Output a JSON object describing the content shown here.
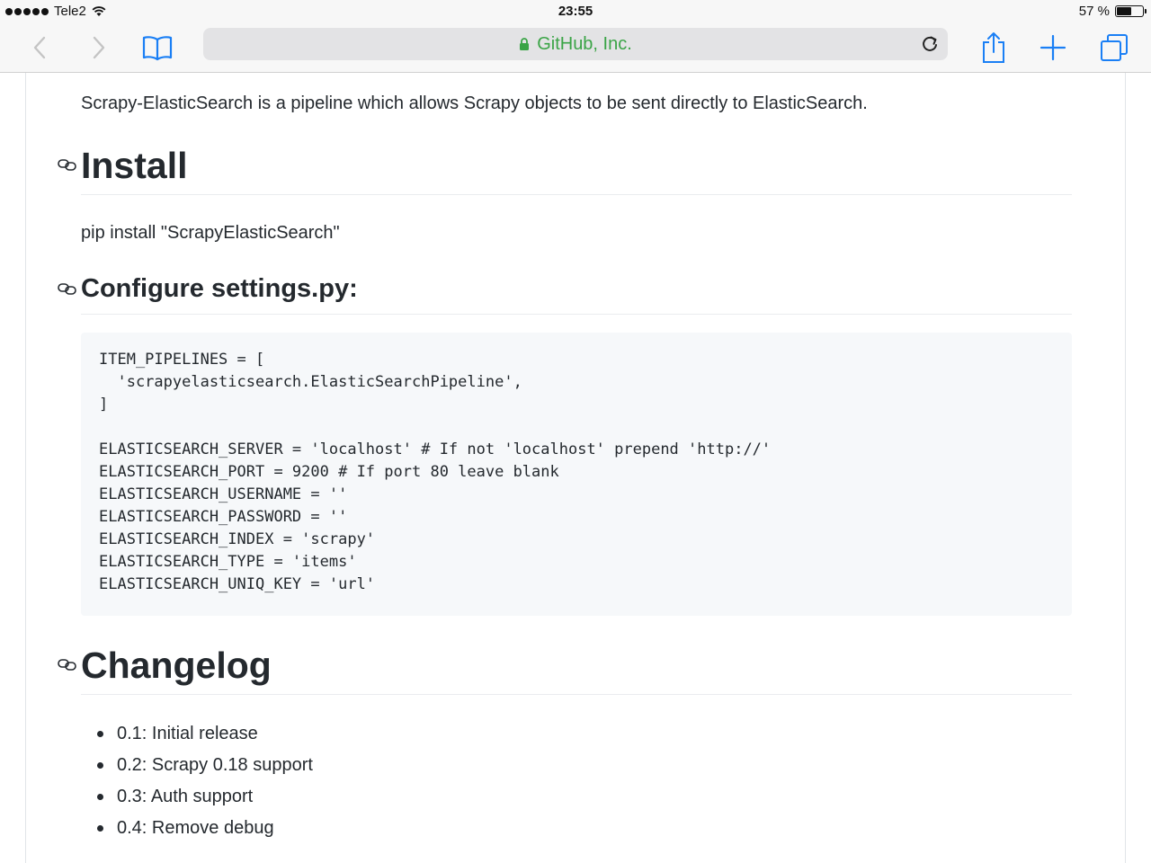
{
  "status_bar": {
    "carrier": "Tele2",
    "time": "23:55",
    "battery_label": "57 %",
    "battery_level": 0.57
  },
  "toolbar": {
    "url_text": "GitHub, Inc.",
    "icons": [
      "back-icon",
      "forward-icon",
      "bookmarks-icon",
      "lock-icon",
      "reload-icon",
      "share-icon",
      "new-tab-icon",
      "tabs-icon"
    ],
    "url_color": "#3aa446",
    "icon_color": "#1a7ff5"
  },
  "content": {
    "intro": "Scrapy-ElasticSearch is a pipeline which allows Scrapy objects to be sent directly to ElasticSearch.",
    "install_heading": "Install",
    "install_command": "pip install \"ScrapyElasticSearch\"",
    "configure_heading": "Configure settings.py:",
    "code_lines": [
      "ITEM_PIPELINES = [",
      "  'scrapyelasticsearch.ElasticSearchPipeline',",
      "]",
      "",
      "ELASTICSEARCH_SERVER = 'localhost' # If not 'localhost' prepend 'http://'",
      "ELASTICSEARCH_PORT = 9200 # If port 80 leave blank",
      "ELASTICSEARCH_USERNAME = ''",
      "ELASTICSEARCH_PASSWORD = ''",
      "ELASTICSEARCH_INDEX = 'scrapy'",
      "ELASTICSEARCH_TYPE = 'items'",
      "ELASTICSEARCH_UNIQ_KEY = 'url'"
    ],
    "changelog_heading": "Changelog",
    "changelog_items": [
      "0.1: Initial release",
      "0.2: Scrapy 0.18 support",
      "0.3: Auth support",
      "0.4: Remove debug"
    ]
  }
}
